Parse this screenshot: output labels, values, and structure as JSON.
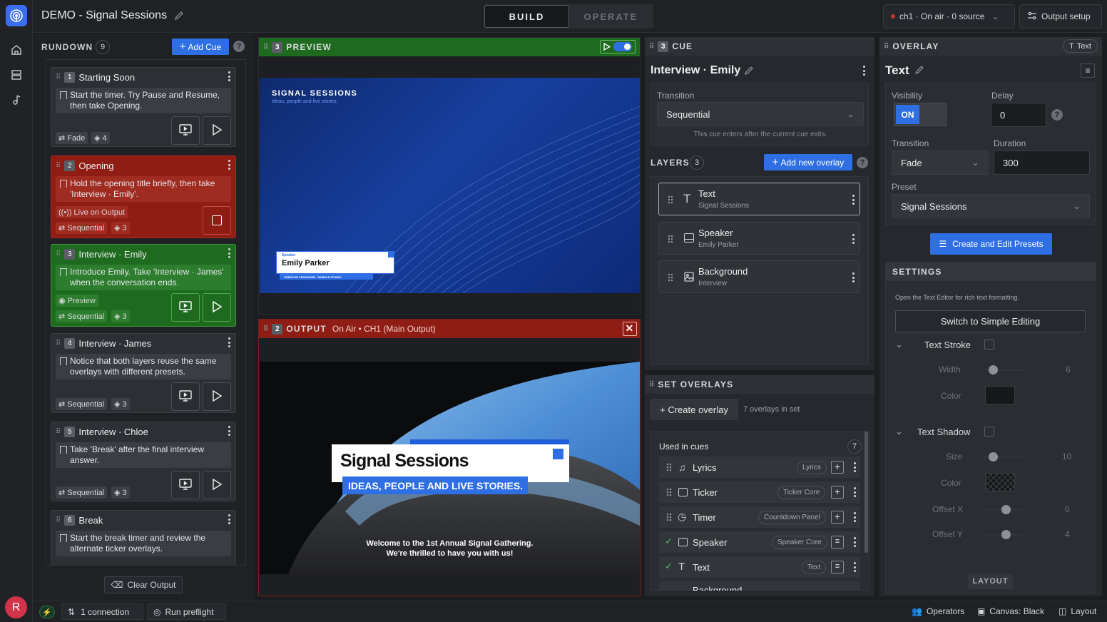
{
  "app": {
    "title": "DEMO - Signal Sessions",
    "modes": [
      "BUILD",
      "OPERATE"
    ],
    "active_mode": "BUILD"
  },
  "topbar": {
    "channel_label": "ch1 · On air · 0 source",
    "output_setup": "Output setup"
  },
  "rundown": {
    "title": "RUNDOWN",
    "count": "9",
    "add_cue": "Add Cue",
    "clear_output": "Clear Output",
    "cues": [
      {
        "num": "1",
        "name": "Starting Soon",
        "note": "Start the timer. Try Pause and Resume, then take Opening.",
        "transition": "Fade",
        "layers": "4",
        "state": "idle"
      },
      {
        "num": "2",
        "name": "Opening",
        "note": "Hold the opening title briefly, then take 'Interview · Emily'.",
        "status": "Live on Output",
        "transition": "Sequential",
        "layers": "3",
        "state": "live"
      },
      {
        "num": "3",
        "name": "Interview · Emily",
        "note": "Introduce Emily. Take 'Interview · James' when the conversation ends.",
        "status": "Preview",
        "transition": "Sequential",
        "layers": "3",
        "state": "preview"
      },
      {
        "num": "4",
        "name": "Interview · James",
        "note": "Notice that both layers reuse the same overlays with different presets.",
        "transition": "Sequential",
        "layers": "3",
        "state": "idle"
      },
      {
        "num": "5",
        "name": "Interview · Chloe",
        "note": "Take 'Break' after the final interview answer.",
        "transition": "Sequential",
        "layers": "3",
        "state": "idle"
      },
      {
        "num": "6",
        "name": "Break",
        "note": "Start the break timer and review the alternate ticker overlays.",
        "state": "idle"
      }
    ]
  },
  "preview": {
    "num": "3",
    "title": "PREVIEW",
    "brand": "SIGNAL SESSIONS",
    "brand_sub": "Ideas, people and live stories.",
    "lt_kicker": "Speaker",
    "lt_name": "Emily Parker",
    "lt_role": "CREATIVE PRODUCER · SAMPLE STUDIO"
  },
  "output": {
    "num": "2",
    "title": "OUTPUT",
    "status": "On Air • CH1 (Main Output)",
    "headline": "Signal Sessions",
    "tagline": "IDEAS, PEOPLE AND LIVE STORIES.",
    "caption_1": "Welcome to the 1st Annual Signal Gathering.",
    "caption_2": "We're thrilled to have you with us!"
  },
  "cue_panel": {
    "num": "3",
    "title": "CUE",
    "cue_name": "Interview · Emily",
    "transition_label": "Transition",
    "transition_value": "Sequential",
    "transition_hint": "This cue enters after the current cue exits.",
    "layers_title": "LAYERS",
    "layers_count": "3",
    "add_overlay": "Add new overlay",
    "layers": [
      {
        "name": "Text",
        "sub": "Signal Sessions",
        "icon": "text-icon"
      },
      {
        "name": "Speaker",
        "sub": "Emily Parker",
        "icon": "lower-third-icon"
      },
      {
        "name": "Background",
        "sub": "Interview",
        "icon": "image-icon"
      }
    ]
  },
  "set_overlays": {
    "title": "SET OVERLAYS",
    "create": "+ Create overlay",
    "count_text": "7 overlays in set",
    "used_title": "Used in cues",
    "used_count": "7",
    "rows": [
      {
        "name": "Lyrics",
        "tag": "Lyrics",
        "icon": "music-icon",
        "used": false
      },
      {
        "name": "Ticker",
        "tag": "Ticker Core",
        "icon": "lower-third-icon",
        "used": false
      },
      {
        "name": "Timer",
        "tag": "Countdown Panel",
        "icon": "clock-icon",
        "used": false
      },
      {
        "name": "Speaker",
        "tag": "Speaker Core",
        "icon": "lower-third-icon",
        "used": true
      },
      {
        "name": "Text",
        "tag": "Text",
        "icon": "text-icon",
        "used": true
      },
      {
        "name": "Background",
        "tag": "",
        "icon": "image-icon",
        "used": true
      }
    ]
  },
  "overlay": {
    "title": "OVERLAY",
    "type_badge": "Text",
    "name": "Text",
    "visibility_label": "Visibility",
    "visibility_value": "ON",
    "delay_label": "Delay",
    "delay_value": "0",
    "transition_label": "Transition",
    "transition_value": "Fade",
    "duration_label": "Duration",
    "duration_value": "300",
    "preset_label": "Preset",
    "preset_value": "Signal Sessions",
    "presets_btn": "Create and Edit Presets",
    "settings_title": "SETTINGS",
    "settings_hint": "Open the Text Editor for rich text formatting.",
    "simple_btn": "Switch to Simple Editing",
    "stroke_label": "Text Stroke",
    "width_label": "Width",
    "width_value": "6",
    "color_label": "Color",
    "shadow_label": "Text Shadow",
    "size_label": "Size",
    "size_value": "10",
    "shadow_color_label": "Color",
    "offx_label": "Offset X",
    "offx_value": "0",
    "offy_label": "Offset Y",
    "offy_value": "4",
    "layout_label": "LAYOUT"
  },
  "statusbar": {
    "connections": "1 connection",
    "preflight": "Run preflight",
    "operators": "Operators",
    "canvas": "Canvas: Black",
    "layout": "Layout"
  },
  "colors": {
    "accent": "#2f6fe4",
    "live": "#8f1d13",
    "preview": "#1e6b1f"
  }
}
